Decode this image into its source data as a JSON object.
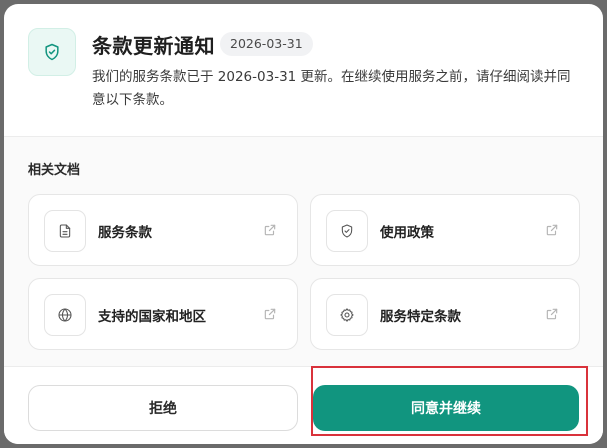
{
  "header": {
    "icon": "shield-check-icon",
    "title": "条款更新通知",
    "date_badge": "2026-03-31",
    "description": "我们的服务条款已于 2026-03-31 更新。在继续使用服务之前，请仔细阅读并同意以下条款。"
  },
  "documents": {
    "section_label": "相关文档",
    "items": [
      {
        "label": "服务条款",
        "icon": "document-icon"
      },
      {
        "label": "使用政策",
        "icon": "shield-check-icon"
      },
      {
        "label": "支持的国家和地区",
        "icon": "globe-icon"
      },
      {
        "label": "服务特定条款",
        "icon": "gear-icon"
      }
    ],
    "external_link_icon": "external-link-icon"
  },
  "footer": {
    "decline_label": "拒绝",
    "accept_label": "同意并继续"
  },
  "colors": {
    "accent": "#11957f",
    "highlight": "#d9323b"
  }
}
